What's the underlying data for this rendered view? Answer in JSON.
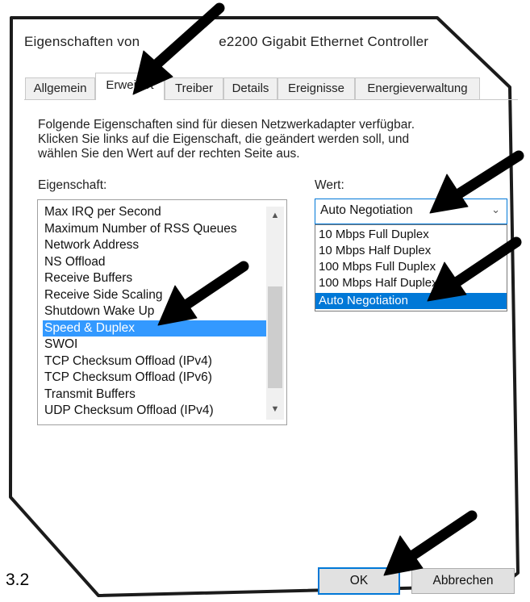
{
  "dialog": {
    "title": "Eigenschaften von Intel(R) 82579LM/I219-LM/e2200 Gigabit Ethernet Controller",
    "title_visible": "Eigenschaften von",
    "title_visible_tail": "e2200 Gigabit Ethernet Controller"
  },
  "tabs": [
    {
      "label": "Allgemein"
    },
    {
      "label": "Erweitert"
    },
    {
      "label": "Treiber"
    },
    {
      "label": "Details"
    },
    {
      "label": "Ereignisse"
    },
    {
      "label": "Energieverwaltung"
    }
  ],
  "active_tab": "Erweitert",
  "description": {
    "line1": "Folgende Eigenschaften sind für diesen Netzwerkadapter verfügbar.",
    "line2": "Klicken Sie links auf die Eigenschaft, die geändert werden soll, und",
    "line3": "wählen Sie den Wert auf der rechten Seite aus."
  },
  "property_label": "Eigenschaft:",
  "value_label": "Wert:",
  "properties": [
    "Max IRQ per Second",
    "Maximum Number of RSS Queues",
    "Network Address",
    "NS Offload",
    "Receive Buffers",
    "Receive Side Scaling",
    "Shutdown Wake Up",
    "Speed & Duplex",
    "SWOI",
    "TCP Checksum Offload (IPv4)",
    "TCP Checksum Offload (IPv6)",
    "Transmit Buffers",
    "UDP Checksum Offload (IPv4)"
  ],
  "selected_property": "Speed & Duplex",
  "value_combo": {
    "selected": "Auto Negotiation",
    "options": [
      "10 Mbps Full Duplex",
      "10 Mbps Half Duplex",
      "100 Mbps Full Duplex",
      "100 Mbps Half Duplex",
      "Auto Negotiation"
    ]
  },
  "buttons": {
    "ok": "OK",
    "cancel": "Abbrechen"
  },
  "corner_label": "3.2",
  "colors": {
    "selection": "#3399ff",
    "dropdown_selection": "#0078d7",
    "arrow": "#000000"
  }
}
